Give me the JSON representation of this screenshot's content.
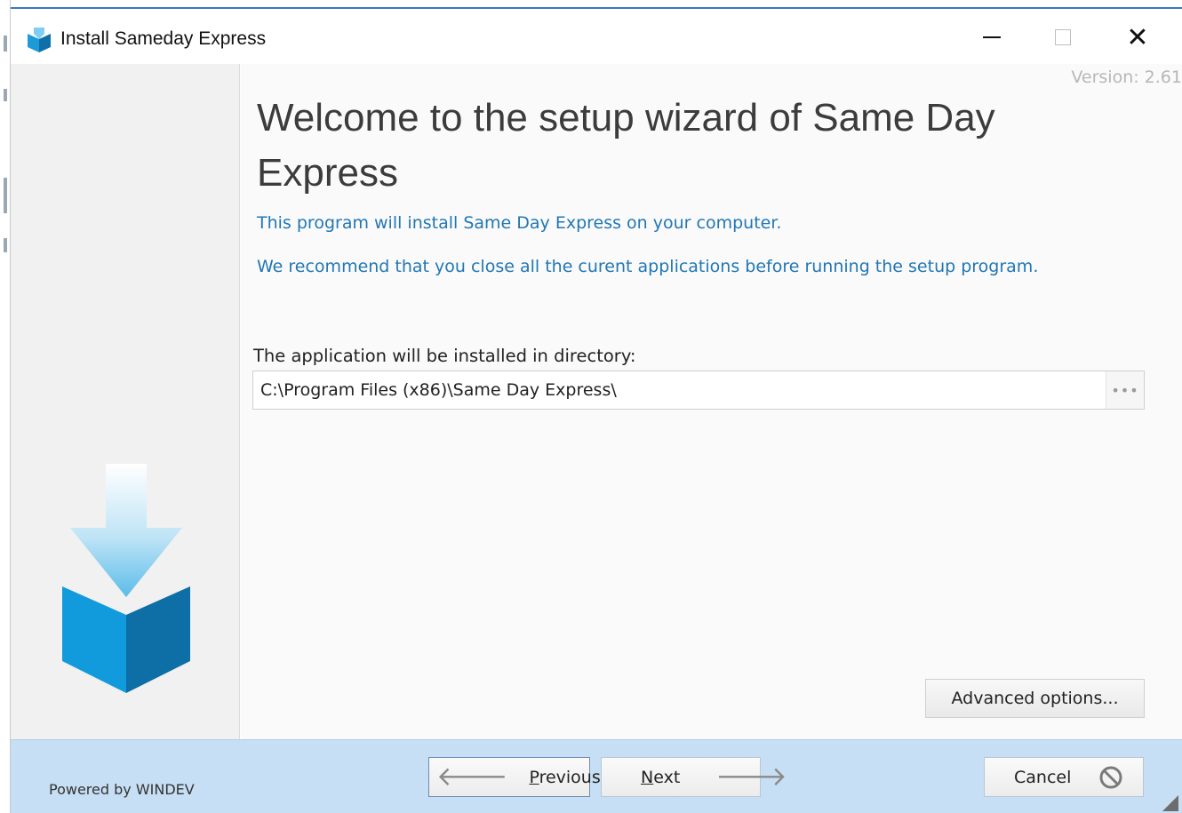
{
  "window": {
    "title": "Install Sameday Express",
    "version_text": "Version: 2.61"
  },
  "content": {
    "heading": "Welcome to the setup wizard of Same Day Express",
    "intro": "This program will install Same Day Express on your computer.",
    "recommendation": "We recommend that you close all the curent applications before running the setup program.",
    "directory_label": "The application will be installed in directory:",
    "directory_value": "C:\\Program Files (x86)\\Same Day Express\\",
    "browse_label": "•••",
    "advanced_label": "Advanced options..."
  },
  "footer": {
    "powered_by": "Powered by WINDEV",
    "previous": {
      "accel": "P",
      "rest": "revious"
    },
    "next": {
      "accel": "N",
      "rest": "ext"
    },
    "cancel_label": "Cancel"
  },
  "icons": {
    "app": "box-download-icon",
    "minimize": "minimize-icon",
    "maximize": "maximize-icon",
    "close": "close-icon",
    "previous": "arrow-left-icon",
    "next": "arrow-right-icon",
    "cancel": "prohibited-icon"
  },
  "colors": {
    "accent_blue": "#2177b4",
    "footer_bg": "#c7dff4",
    "sidebar_bg": "#f1f1f1"
  }
}
